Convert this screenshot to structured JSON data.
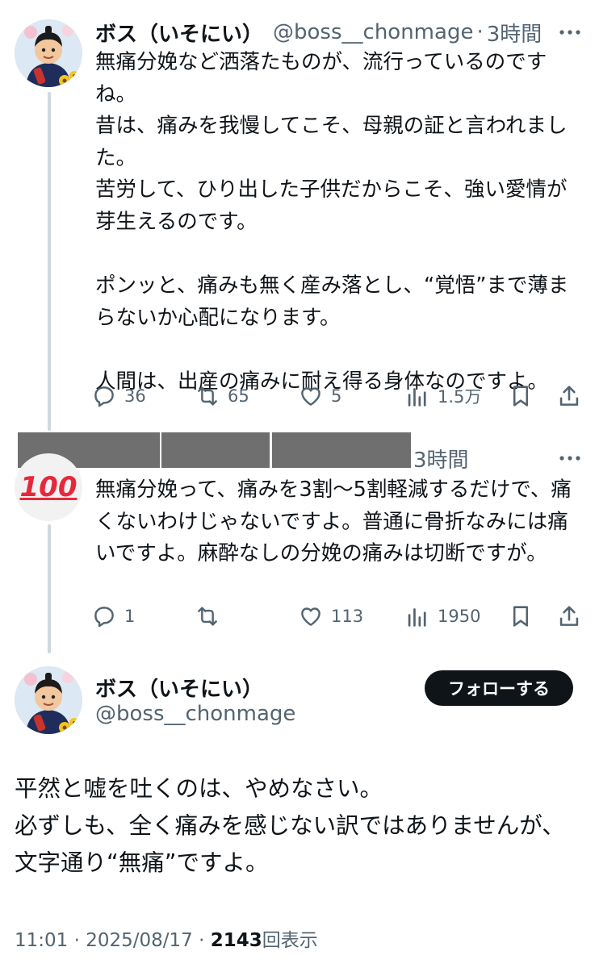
{
  "tweets": [
    {
      "name": "ボス（いそにい）",
      "handle": "@boss__chonmage",
      "separator": "·",
      "time": "3時間",
      "text": "無痛分娩など洒落たものが、流行っているのですね。\n昔は、痛みを我慢してこそ、母親の証と言われました。\n苦労して、ひり出した子供だからこそ、強い愛情が芽生えるのです。\n\nポンッと、痛みも無く産み落とし、“覚悟”まで薄まらないか心配になります。\n\n人間は、出産の痛みに耐え得る身体なのですよ。",
      "replies": "36",
      "retweets": "65",
      "likes": "5",
      "views": "1.5万"
    },
    {
      "name": "",
      "handle": "",
      "time": "3時間",
      "avatar_emoji": "100",
      "text": "無痛分娩って、痛みを3割〜5割軽減するだけで、痛くないわけじゃないですよ。普通に骨折なみには痛いですよ。麻酔なしの分娩の痛みは切断ですが。",
      "replies": "1",
      "retweets": "",
      "likes": "113",
      "views": "1950"
    }
  ],
  "main_tweet": {
    "name": "ボス（いそにい）",
    "handle": "@boss__chonmage",
    "follow_label": "フォローする",
    "text": "平然と嘘を吐くのは、やめなさい。\n必ずしも、全く痛みを感じない訳ではありませんが、文字通り“無痛”ですよ。",
    "time": "11:01",
    "sep1": "·",
    "date": "2025/08/17",
    "sep2": "·",
    "view_count": "2143",
    "view_label": "回表示"
  },
  "icons": [
    "more-icon",
    "reply-icon",
    "retweet-icon",
    "like-icon",
    "views-icon",
    "bookmark-icon",
    "share-icon"
  ],
  "colors": {
    "text": "#0f1419",
    "secondary": "#536471",
    "thread_line": "#cfd9de",
    "button_bg": "#0f1419",
    "redaction": "#6f6f6f",
    "emoji_red": "#e8283a"
  }
}
